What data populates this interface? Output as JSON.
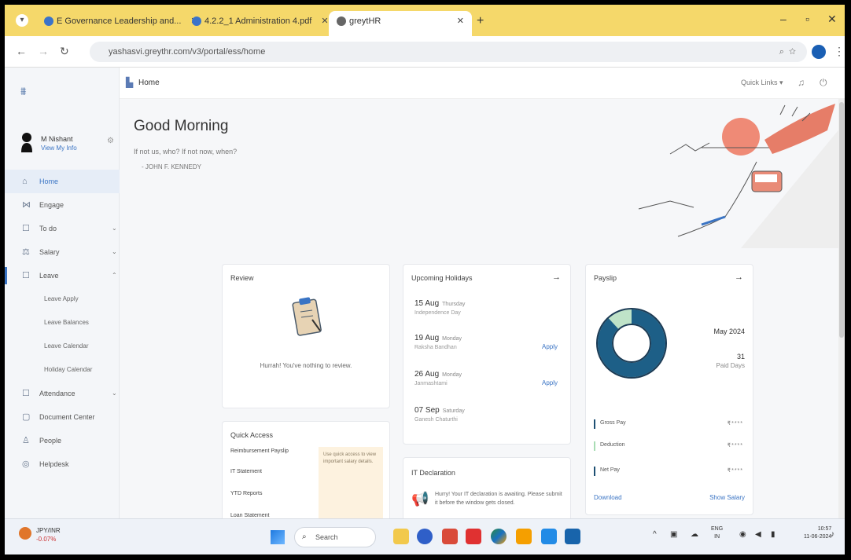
{
  "browser": {
    "tabs": [
      {
        "label": "E Governance Leadership and...",
        "active": false
      },
      {
        "label": "4.2.2_1 Administration 4.pdf",
        "active": false
      },
      {
        "label": "greytHR",
        "active": true
      }
    ],
    "url": "yashasvi.greythr.com/v3/portal/ess/home"
  },
  "sidebar": {
    "user_name": "M Nishant",
    "user_link": "View My Info",
    "nav": [
      {
        "label": "Home",
        "icon": "home-icon",
        "active": true
      },
      {
        "label": "Engage",
        "icon": "engage-icon"
      },
      {
        "label": "To do",
        "icon": "todo-icon",
        "chevron": true
      },
      {
        "label": "Salary",
        "icon": "salary-icon",
        "chevron": true
      },
      {
        "label": "Leave",
        "icon": "leave-icon",
        "chevron": true,
        "expanded": true
      }
    ],
    "leave_sub": [
      "Leave Apply",
      "Leave Balances",
      "Leave Calendar",
      "Holiday Calendar"
    ],
    "nav_after": [
      {
        "label": "Attendance",
        "icon": "attendance-icon",
        "chevron": true
      },
      {
        "label": "Document Center",
        "icon": "document-icon"
      },
      {
        "label": "People",
        "icon": "people-icon"
      },
      {
        "label": "Helpdesk",
        "icon": "helpdesk-icon"
      }
    ]
  },
  "header": {
    "page": "Home",
    "quick_links": "Quick Links"
  },
  "main": {
    "greeting": "Good Morning",
    "quote": "If not us, who? If not now, when?",
    "author": "- JOHN F. KENNEDY"
  },
  "review": {
    "title": "Review",
    "message": "Hurrah! You've nothing to review."
  },
  "holidays": {
    "title": "Upcoming Holidays",
    "items": [
      {
        "date": "15 Aug",
        "day": "Thursday",
        "name": "Independence Day",
        "apply": ""
      },
      {
        "date": "19 Aug",
        "day": "Monday",
        "name": "Raksha Bandhan",
        "apply": "Apply"
      },
      {
        "date": "26 Aug",
        "day": "Monday",
        "name": "Janmashtami",
        "apply": "Apply"
      },
      {
        "date": "07 Sep",
        "day": "Saturday",
        "name": "Ganesh Chaturthi",
        "apply": ""
      }
    ]
  },
  "payslip": {
    "title": "Payslip",
    "month": "May 2024",
    "paid_days": "31",
    "paid_days_label": "Paid Days",
    "donut_fraction": 0.88,
    "rows": [
      {
        "label": "Gross Pay",
        "value": "₹****",
        "color": "#1d4f73"
      },
      {
        "label": "Deduction",
        "value": "₹****",
        "color": "#a8dcb4"
      },
      {
        "label": "Net Pay",
        "value": "₹****",
        "color": "#1d4f73"
      }
    ],
    "download": "Download",
    "show_salary": "Show Salary"
  },
  "quick_access": {
    "title": "Quick Access",
    "items": [
      "Reimbursement Payslip",
      "IT Statement",
      "YTD Reports",
      "Loan Statement"
    ],
    "note": "Use quick access to view important salary details."
  },
  "it_declaration": {
    "title": "IT Declaration",
    "message": "Hurry! Your IT declaration is awaiting. Please submit it before the window gets closed."
  },
  "taskbar": {
    "stock_name": "JPY/INR",
    "stock_change": "-0.07%",
    "search": "Search",
    "lang_top": "ENG",
    "lang_bottom": "IN",
    "time": "10:57",
    "date": "11-06-2024"
  },
  "colors": {
    "accent": "#3a74c4",
    "donut_main": "#1d5f87",
    "donut_light": "#bfe3c8",
    "tabbar": "#f5d86a"
  }
}
